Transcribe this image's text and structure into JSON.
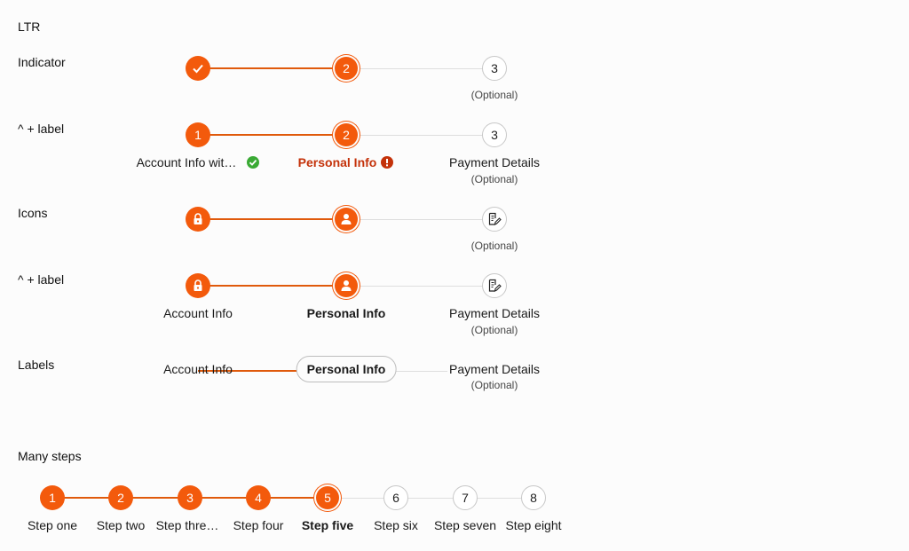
{
  "section_ltr": "LTR",
  "rows": {
    "indicator": {
      "title": "Indicator",
      "steps": [
        "",
        "2",
        "3"
      ],
      "optional": "(Optional)"
    },
    "indicator_label": {
      "title": "^ + label",
      "steps": [
        "1",
        "2",
        "3"
      ],
      "labels": [
        "Account Info wit…",
        "Personal Info",
        "Payment Details"
      ],
      "optional": "(Optional)"
    },
    "icons": {
      "title": "Icons",
      "optional": "(Optional)"
    },
    "icons_label": {
      "title": "^ + label",
      "labels": [
        "Account Info",
        "Personal Info",
        "Payment Details"
      ],
      "optional": "(Optional)"
    },
    "labels": {
      "title": "Labels",
      "labels": [
        "Account Info",
        "Personal Info",
        "Payment Details"
      ],
      "optional": "(Optional)"
    }
  },
  "many_steps": {
    "title": "Many steps",
    "numbers": [
      "1",
      "2",
      "3",
      "4",
      "5",
      "6",
      "7",
      "8"
    ],
    "labels": [
      "Step one",
      "Step two",
      "Step thre…",
      "Step four",
      "Step five",
      "Step six",
      "Step seven",
      "Step eight"
    ]
  },
  "colors": {
    "accent": "#f35a0c",
    "error": "#c4320a",
    "success": "#3aaa35"
  }
}
